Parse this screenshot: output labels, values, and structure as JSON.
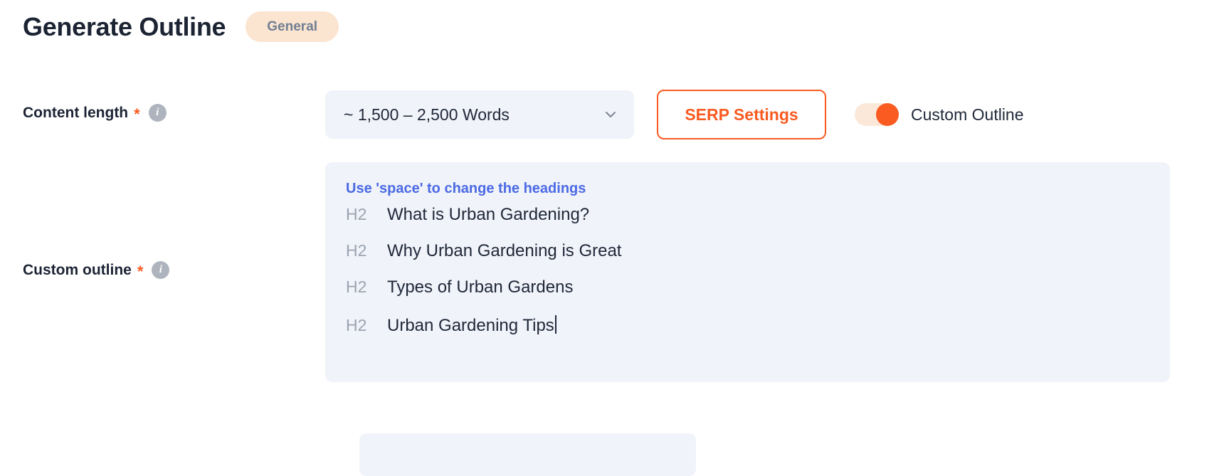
{
  "header": {
    "title": "Generate Outline",
    "badge": "General"
  },
  "form": {
    "content_length": {
      "label": "Content length",
      "required_marker": "*",
      "info_icon": "info-icon",
      "select_value": "~ 1,500 – 2,500 Words",
      "chevron_icon": "chevron-down-icon"
    },
    "serp_settings_button": "SERP Settings",
    "custom_outline_toggle": {
      "label": "Custom Outline",
      "state": "on"
    },
    "custom_outline": {
      "label": "Custom outline",
      "required_marker": "*",
      "info_icon": "info-icon"
    }
  },
  "outline": {
    "hint": "Use 'space' to change the headings",
    "headings": [
      {
        "tag": "H2",
        "text": "What is Urban Gardening?",
        "active": false
      },
      {
        "tag": "H2",
        "text": "Why Urban Gardening is Great",
        "active": false
      },
      {
        "tag": "H2",
        "text": "Types of Urban Gardens",
        "active": false
      },
      {
        "tag": "H2",
        "text": "Urban Gardening Tips",
        "active": true
      }
    ]
  },
  "colors": {
    "accent_orange": "#f95b21",
    "panel_bg": "#f0f3f9",
    "badge_bg": "#fbe4d0",
    "hint_blue": "#4b6ae4",
    "text_dark": "#1f2738"
  }
}
